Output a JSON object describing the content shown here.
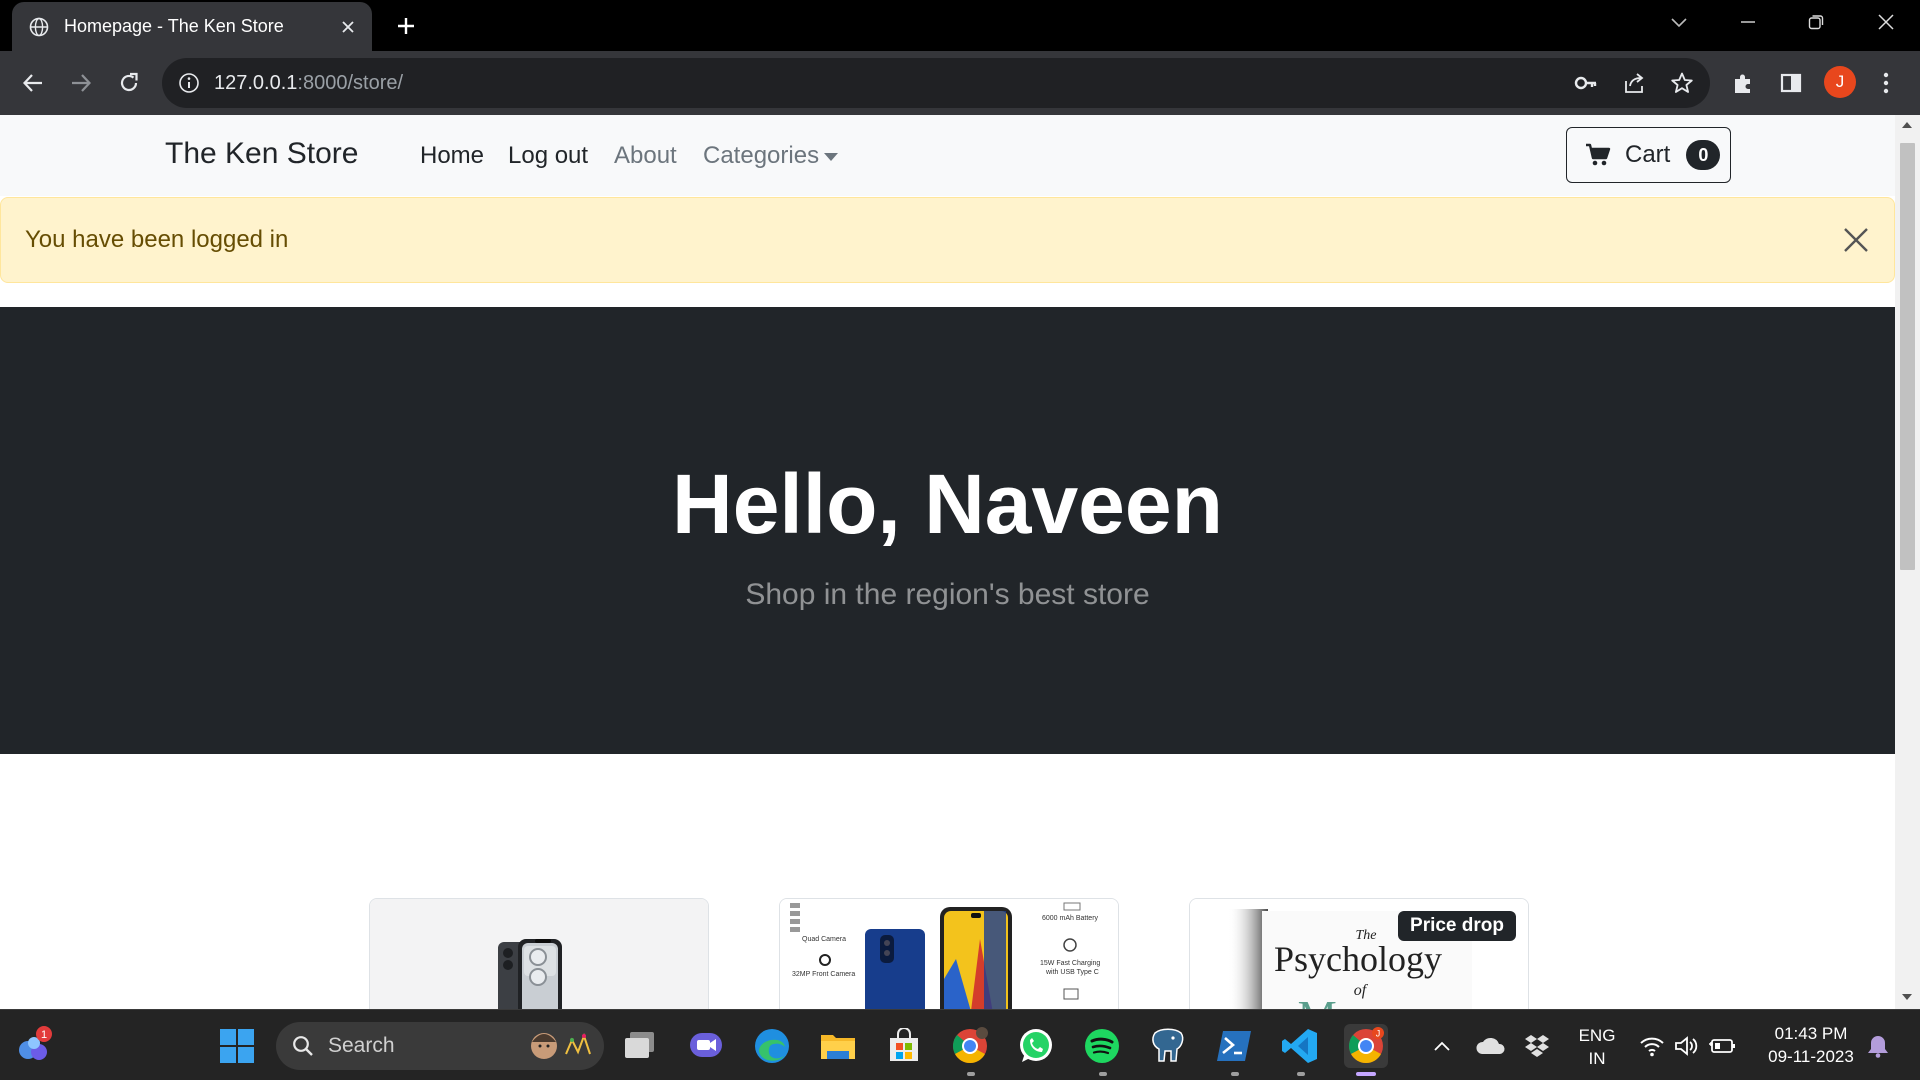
{
  "browser": {
    "tab_title": "Homepage - The Ken Store",
    "url_host": "127.0.0.1",
    "url_rest": ":8000/store/",
    "profile_initial": "J"
  },
  "navbar": {
    "brand": "The Ken Store",
    "links": [
      "Home",
      "Log out",
      "About",
      "Categories"
    ],
    "cart_label": "Cart",
    "cart_count": "0"
  },
  "alert": {
    "message": "You have been logged in"
  },
  "hero": {
    "heading": "Hello, Naveen",
    "subheading": "Shop in the region's best store"
  },
  "products": [
    {
      "image": "phone-product",
      "badge": ""
    },
    {
      "image": "samsung-phone-box",
      "badge": ""
    },
    {
      "image": "psychology-of-money-book",
      "badge": "Price drop"
    }
  ],
  "book_cover": {
    "line1": "The",
    "line2": "Psychology",
    "line3": "of",
    "line4": "Money"
  },
  "phone_box_text": {
    "left1": "Quad Camera",
    "left2": "32MP Front Camera",
    "right1": "6000 mAh Battery",
    "right2": "15W Fast Charging",
    "right3": "with USB Type C"
  },
  "taskbar": {
    "search_label": "Search",
    "notification_count": "1",
    "lang_line1": "ENG",
    "lang_line2": "IN",
    "time": "01:43 PM",
    "date": "09-11-2023"
  },
  "colors": {
    "hero_bg": "#212529",
    "alert_bg": "#fff3cd",
    "alert_text": "#664d03",
    "navbar_bg": "#f8f9fa",
    "profile_avatar": "#e8471d"
  }
}
